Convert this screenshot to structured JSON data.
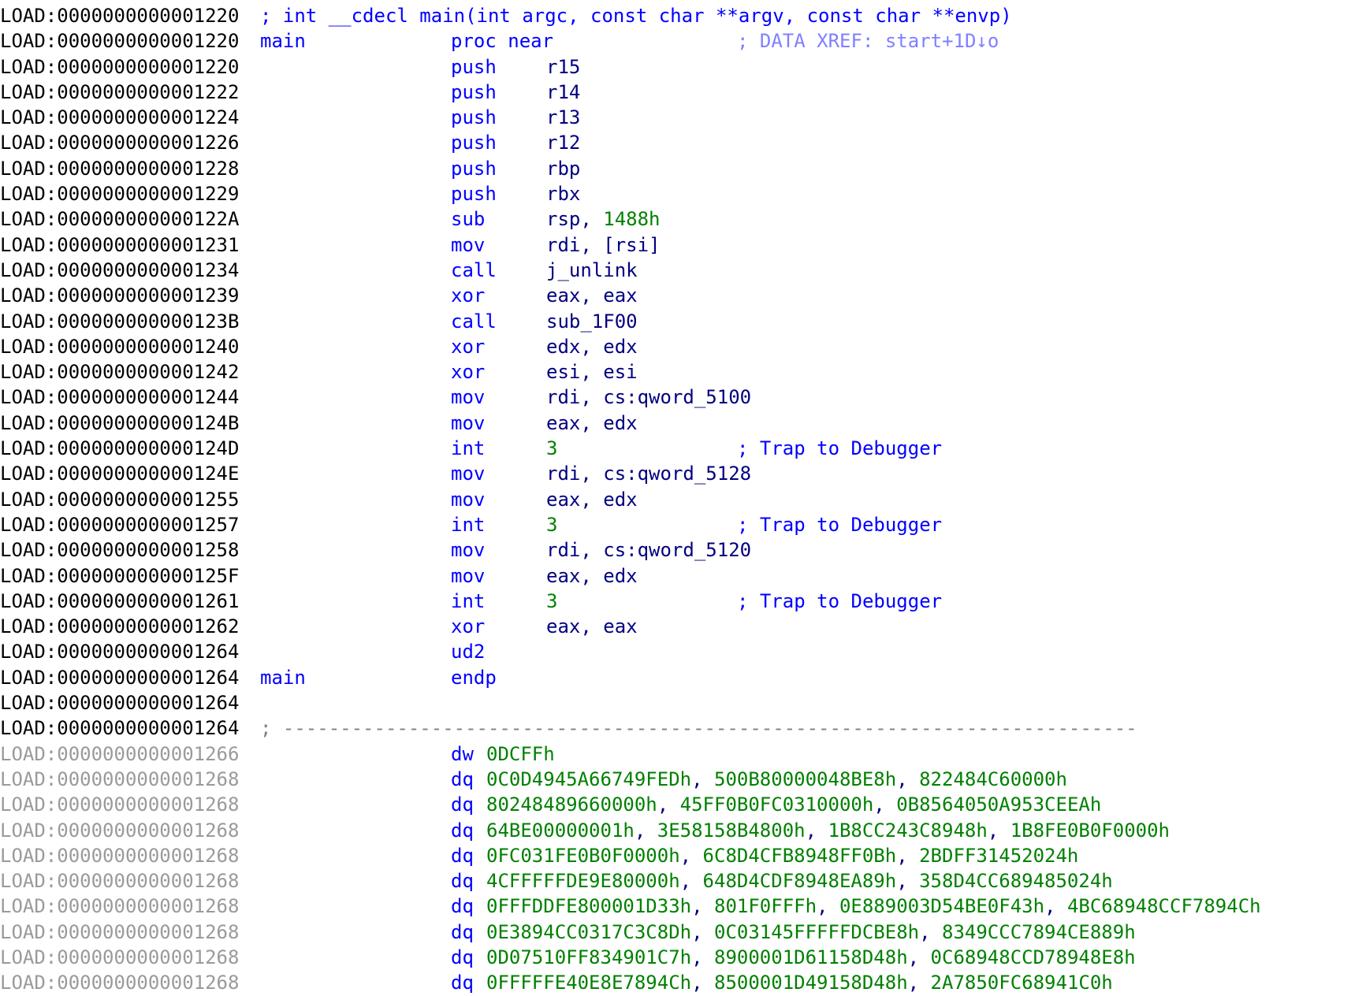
{
  "lines": [
    {
      "addr": "LOAD:0000000000001220",
      "kind": "full",
      "text": "; int __cdecl main(int argc, const char **argv, const char **envp)"
    },
    {
      "addr": "LOAD:0000000000001220",
      "kind": "proc",
      "label": "main",
      "mnem": "proc near",
      "comment": "; DATA XREF: start+1D↓o"
    },
    {
      "addr": "LOAD:0000000000001220",
      "kind": "ins",
      "mnem": "push",
      "ops": "r15"
    },
    {
      "addr": "LOAD:0000000000001222",
      "kind": "ins",
      "mnem": "push",
      "ops": "r14"
    },
    {
      "addr": "LOAD:0000000000001224",
      "kind": "ins",
      "mnem": "push",
      "ops": "r13"
    },
    {
      "addr": "LOAD:0000000000001226",
      "kind": "ins",
      "mnem": "push",
      "ops": "r12"
    },
    {
      "addr": "LOAD:0000000000001228",
      "kind": "ins",
      "mnem": "push",
      "ops": "rbp"
    },
    {
      "addr": "LOAD:0000000000001229",
      "kind": "ins",
      "mnem": "push",
      "ops": "rbx"
    },
    {
      "addr": "LOAD:000000000000122A",
      "kind": "ins",
      "mnem": "sub",
      "ops": "rsp, ",
      "num": "1488h"
    },
    {
      "addr": "LOAD:0000000000001231",
      "kind": "ins",
      "mnem": "mov",
      "ops": "rdi, [rsi]"
    },
    {
      "addr": "LOAD:0000000000001234",
      "kind": "ins",
      "mnem": "call",
      "ops": "j_unlink"
    },
    {
      "addr": "LOAD:0000000000001239",
      "kind": "ins",
      "mnem": "xor",
      "ops": "eax, eax"
    },
    {
      "addr": "LOAD:000000000000123B",
      "kind": "ins",
      "mnem": "call",
      "ops": "sub_1F00"
    },
    {
      "addr": "LOAD:0000000000001240",
      "kind": "ins",
      "mnem": "xor",
      "ops": "edx, edx"
    },
    {
      "addr": "LOAD:0000000000001242",
      "kind": "ins",
      "mnem": "xor",
      "ops": "esi, esi"
    },
    {
      "addr": "LOAD:0000000000001244",
      "kind": "ins",
      "mnem": "mov",
      "ops": "rdi, cs:qword_5100"
    },
    {
      "addr": "LOAD:000000000000124B",
      "kind": "ins",
      "mnem": "mov",
      "ops": "eax, edx"
    },
    {
      "addr": "LOAD:000000000000124D",
      "kind": "ins",
      "mnem": "int",
      "num": "3",
      "comment": "; Trap to Debugger"
    },
    {
      "addr": "LOAD:000000000000124E",
      "kind": "ins",
      "mnem": "mov",
      "ops": "rdi, cs:qword_5128"
    },
    {
      "addr": "LOAD:0000000000001255",
      "kind": "ins",
      "mnem": "mov",
      "ops": "eax, edx"
    },
    {
      "addr": "LOAD:0000000000001257",
      "kind": "ins",
      "mnem": "int",
      "num": "3",
      "comment": "; Trap to Debugger"
    },
    {
      "addr": "LOAD:0000000000001258",
      "kind": "ins",
      "mnem": "mov",
      "ops": "rdi, cs:qword_5120"
    },
    {
      "addr": "LOAD:000000000000125F",
      "kind": "ins",
      "mnem": "mov",
      "ops": "eax, edx"
    },
    {
      "addr": "LOAD:0000000000001261",
      "kind": "ins",
      "mnem": "int",
      "num": "3",
      "comment": "; Trap to Debugger"
    },
    {
      "addr": "LOAD:0000000000001262",
      "kind": "ins",
      "mnem": "xor",
      "ops": "eax, eax"
    },
    {
      "addr": "LOAD:0000000000001264",
      "kind": "ins",
      "mnem": "ud2"
    },
    {
      "addr": "LOAD:0000000000001264",
      "kind": "proc",
      "label": "main",
      "mnem": "endp"
    },
    {
      "addr": "LOAD:0000000000001264",
      "kind": "empty"
    },
    {
      "addr": "LOAD:0000000000001264",
      "kind": "sep",
      "text": "; ---------------------------------------------------------------------------"
    },
    {
      "addr": "LOAD:0000000000001266",
      "kind": "data",
      "gray": true,
      "mnem": "dw",
      "values": [
        "0DCFFh"
      ]
    },
    {
      "addr": "LOAD:0000000000001268",
      "kind": "data",
      "gray": true,
      "mnem": "dq",
      "values": [
        "0C0D4945A66749FEDh",
        "500B80000048BE8h",
        "822484C60000h"
      ]
    },
    {
      "addr": "LOAD:0000000000001268",
      "kind": "data",
      "gray": true,
      "mnem": "dq",
      "values": [
        "80248489660000h",
        "45FF0B0FC0310000h",
        "0B8564050A953CEEAh"
      ]
    },
    {
      "addr": "LOAD:0000000000001268",
      "kind": "data",
      "gray": true,
      "mnem": "dq",
      "values": [
        "64BE00000001h",
        "3E58158B4800h",
        "1B8CC243C8948h",
        "1B8FE0B0F0000h"
      ]
    },
    {
      "addr": "LOAD:0000000000001268",
      "kind": "data",
      "gray": true,
      "mnem": "dq",
      "values": [
        "0FC031FE0B0F0000h",
        "6C8D4CFB8948FF0Bh",
        "2BDFF31452024h"
      ]
    },
    {
      "addr": "LOAD:0000000000001268",
      "kind": "data",
      "gray": true,
      "mnem": "dq",
      "values": [
        "4CFFFFFDE9E80000h",
        "648D4CDF8948EA89h",
        "358D4CC689485024h"
      ]
    },
    {
      "addr": "LOAD:0000000000001268",
      "kind": "data",
      "gray": true,
      "mnem": "dq",
      "values": [
        "0FFFDDFE800001D33h",
        "801F0FFFh",
        "0E889003D54BE0F43h",
        "4BC68948CCF7894Ch"
      ]
    },
    {
      "addr": "LOAD:0000000000001268",
      "kind": "data",
      "gray": true,
      "mnem": "dq",
      "values": [
        "0E3894CC0317C3C8Dh",
        "0C03145FFFFFDCBE8h",
        "8349CCC7894CE889h"
      ]
    },
    {
      "addr": "LOAD:0000000000001268",
      "kind": "data",
      "gray": true,
      "mnem": "dq",
      "values": [
        "0D07510FF834901C7h",
        "8900001D61158D48h",
        "0C68948CCD78948E8h"
      ]
    },
    {
      "addr": "LOAD:0000000000001268",
      "kind": "data",
      "gray": true,
      "mnem": "dq",
      "values": [
        "0FFFFFE40E8E7894Ch",
        "8500001D49158D48h",
        "2A7850FC68941C0h"
      ]
    }
  ],
  "colors": {
    "address_black": "#000000",
    "address_gray": "#9a9a9a",
    "keyword_blue": "#0000ff",
    "operand_navy": "#000080",
    "number_green": "#008000",
    "xref_light": "#8080ff",
    "separator_gray": "#808080"
  }
}
